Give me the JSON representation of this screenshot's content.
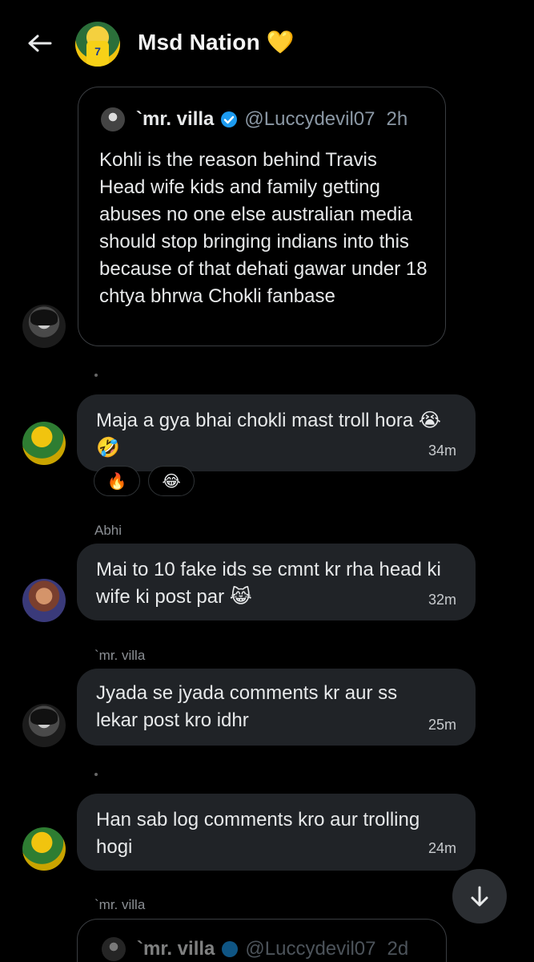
{
  "header": {
    "title": "Msd Nation 💛",
    "back_icon": "arrow-left-icon",
    "jersey_number": "7"
  },
  "quoted_post": {
    "name": "`mr. villa",
    "handle": "@Luccydevil07",
    "time": "2h",
    "text": "Kohli is the reason behind Travis Head wife kids and family getting abuses no one else australian media should stop bringing indians into this because of that dehati gawar under 18 chtya bhrwa Chokli fanbase"
  },
  "messages": [
    {
      "text": "Maja a gya bhai chokli mast troll hora 😭🤣",
      "time": "34m"
    },
    {
      "sender": "Abhi",
      "text": "Mai to 10 fake ids se cmnt kr rha head ki wife ki post par 😹",
      "time": "32m"
    },
    {
      "sender": "`mr. villa",
      "text": "Jyada se jyada comments kr aur ss lekar post kro idhr",
      "time": "25m"
    },
    {
      "text": "Han sab log comments kro aur  trolling hogi",
      "time": "24m"
    }
  ],
  "reactions": [
    "🔥",
    "😂"
  ],
  "last_sender": "`mr. villa",
  "quoted_post_2": {
    "name": "`mr. villa",
    "handle": "@Luccydevil07",
    "time": "2d"
  },
  "colors": {
    "background": "#000000",
    "bubble": "#202327",
    "verified": "#1d9bf0",
    "muted": "#8b98a5"
  }
}
